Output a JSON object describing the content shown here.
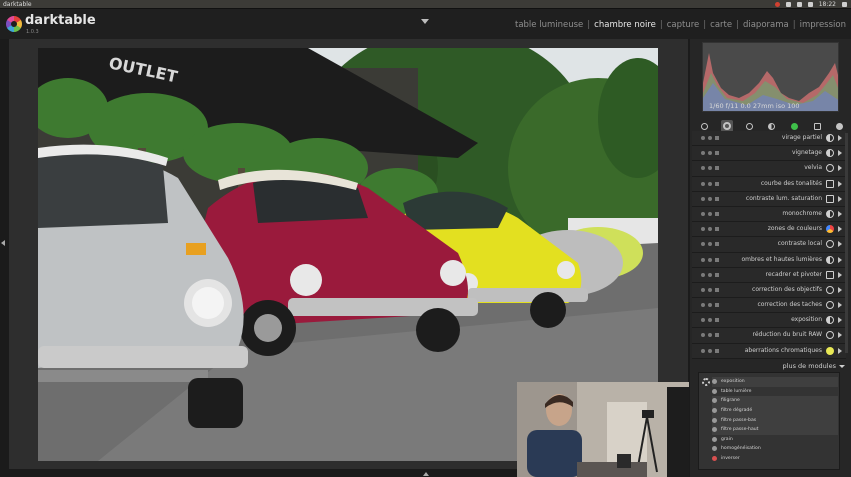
{
  "os_bar": {
    "title": "darktable",
    "clock": "18:22"
  },
  "app": {
    "name": "darktable",
    "version": "1.0.3"
  },
  "views": [
    {
      "label": "table lumineuse",
      "active": false
    },
    {
      "label": "chambre noire",
      "active": true
    },
    {
      "label": "capture",
      "active": false
    },
    {
      "label": "carte",
      "active": false
    },
    {
      "label": "diaporama",
      "active": false
    },
    {
      "label": "impression",
      "active": false
    }
  ],
  "histogram": {
    "info": "1/60 f/11 0.0 27mm iso 100"
  },
  "module_groups": [
    "active-modules-icon",
    "favorites-icon",
    "basic-group-icon",
    "tone-group-icon",
    "color-group-icon",
    "correct-group-icon",
    "effects-group-icon"
  ],
  "modules": [
    {
      "name": "virage partiel",
      "icon": "half"
    },
    {
      "name": "vignetage",
      "icon": "half"
    },
    {
      "name": "velvia",
      "icon": "ring"
    },
    {
      "name": "courbe des tonalités",
      "icon": "sq"
    },
    {
      "name": "contraste lum. saturation",
      "icon": "sq"
    },
    {
      "name": "monochrome",
      "icon": "half"
    },
    {
      "name": "zones de couleurs",
      "icon": "color"
    },
    {
      "name": "contraste local",
      "icon": "ring"
    },
    {
      "name": "ombres et hautes lumières",
      "icon": "half"
    },
    {
      "name": "recadrer et pivoter",
      "icon": "sq"
    },
    {
      "name": "correction des objectifs",
      "icon": "ring"
    },
    {
      "name": "correction des taches",
      "icon": "ring"
    },
    {
      "name": "exposition",
      "icon": "half"
    },
    {
      "name": "réduction du bruit RAW",
      "icon": "ring"
    },
    {
      "name": "aberrations chromatiques",
      "icon": "yellow"
    }
  ],
  "more_modules": {
    "label": "plus de modules",
    "items": [
      {
        "label": "exposition",
        "icon": "dot",
        "selected": true
      },
      {
        "label": "table lumière",
        "icon": "dot",
        "selected": false
      },
      {
        "label": "filigrane",
        "icon": "dot",
        "selected": true
      },
      {
        "label": "filtre dégradé",
        "icon": "dot",
        "selected": true
      },
      {
        "label": "filtre passe-bas",
        "icon": "dot",
        "selected": true
      },
      {
        "label": "filtre passe-haut",
        "icon": "dot",
        "selected": true
      },
      {
        "label": "grain",
        "icon": "dot",
        "selected": false
      },
      {
        "label": "homogénéisation",
        "icon": "dot",
        "selected": false
      },
      {
        "label": "inverser",
        "icon": "red",
        "selected": false
      }
    ]
  }
}
